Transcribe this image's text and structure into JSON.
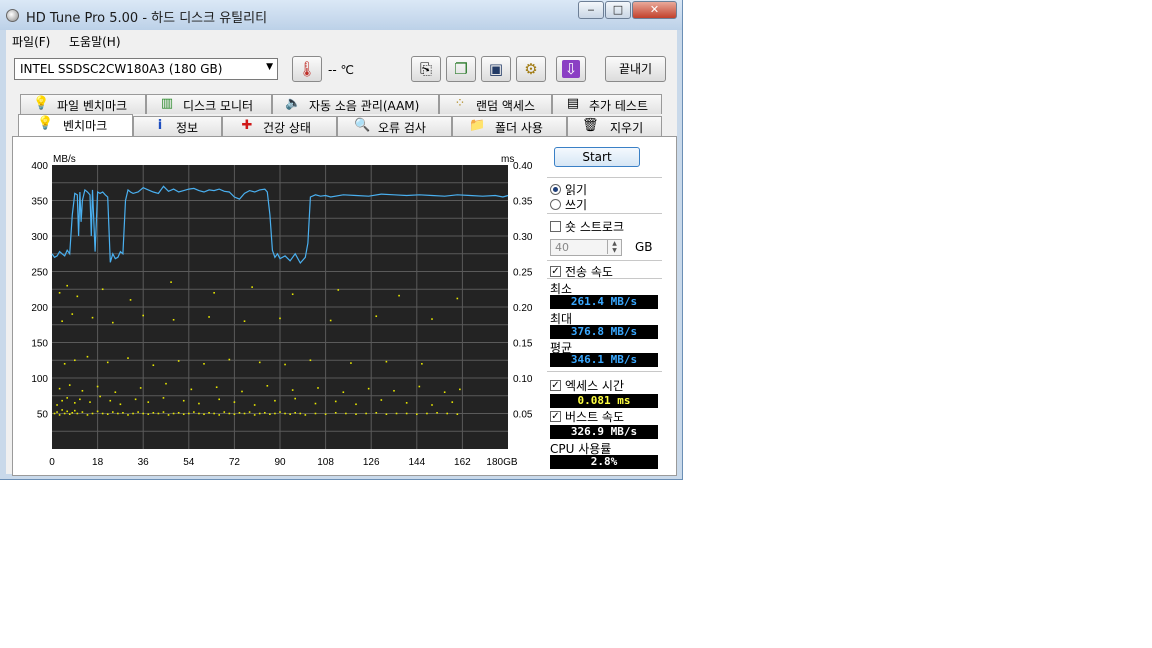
{
  "window": {
    "title": "HD Tune Pro 5.00 - 하드 디스크 유틸리티",
    "controls": {
      "minimize": "‒",
      "maximize": "□",
      "close": "✕"
    }
  },
  "menu": {
    "file": "파일(F)",
    "help": "도움말(H)"
  },
  "toolbar": {
    "drive": "INTEL SSDSC2CW180A3 (180 GB)",
    "temperature": "-- ℃",
    "exit_label": "끝내기",
    "icons": [
      "thermometer-icon",
      "copy-icon",
      "copy-all-icon",
      "save-icon",
      "options-icon",
      "download-icon"
    ]
  },
  "tabs_top": [
    "파일 벤치마크",
    "디스크 모니터",
    "자동 소음 관리(AAM)",
    "랜덤 액세스",
    "추가 테스트"
  ],
  "tabs_bottom": [
    "벤치마크",
    "정보",
    "건강 상태",
    "오류 검사",
    "폴더 사용",
    "지우기"
  ],
  "active_tab": "벤치마크",
  "controls": {
    "start_label": "Start",
    "read_label": "읽기",
    "write_label": "쓰기",
    "mode": "read",
    "short_stroke_label": "숏 스트로크",
    "short_stroke_checked": false,
    "short_stroke_value": "40",
    "short_stroke_unit": "GB",
    "transfer_rate_label": "전송 속도",
    "transfer_rate_checked": true,
    "min_label": "최소",
    "min_value": "261.4 MB/s",
    "max_label": "최대",
    "max_value": "376.8 MB/s",
    "avg_label": "평균",
    "avg_value": "346.1 MB/s",
    "access_time_label": "엑세스 시간",
    "access_time_checked": true,
    "access_time_value": "0.081 ms",
    "burst_label": "버스트 속도",
    "burst_checked": true,
    "burst_value": "326.9 MB/s",
    "cpu_label": "CPU 사용률",
    "cpu_value": "2.8%"
  },
  "colors": {
    "line": "#4ab0f0",
    "points": "#e8e800",
    "value_blue": "#3aa8ff",
    "value_yellow": "#ffff40",
    "value_white": "#ffffff"
  },
  "chart_data": {
    "type": "line",
    "left_unit": "MB/s",
    "right_unit": "ms",
    "x_ticks": [
      "0",
      "18",
      "36",
      "54",
      "72",
      "90",
      "108",
      "126",
      "144",
      "162",
      "180GB"
    ],
    "y_left_ticks": [
      "400",
      "350",
      "300",
      "250",
      "200",
      "150",
      "100",
      "50"
    ],
    "y_right_ticks": [
      "0.40",
      "0.35",
      "0.30",
      "0.25",
      "0.20",
      "0.15",
      "0.10",
      "0.05"
    ],
    "xlim": [
      0,
      180
    ],
    "ylim_left": [
      0,
      400
    ],
    "ylim_right": [
      0,
      0.4
    ],
    "grid": true,
    "series": [
      {
        "axis": "left",
        "x": [
          0,
          1,
          2,
          3,
          4,
          5,
          6,
          7,
          8,
          9,
          10,
          10.5,
          11,
          11.5,
          12,
          13,
          14,
          15,
          15.5,
          16,
          17,
          18,
          19,
          20,
          21,
          22,
          23,
          24,
          25,
          26,
          27,
          28,
          29,
          30,
          31,
          32,
          34,
          36,
          38,
          40,
          42,
          44,
          46,
          48,
          50,
          52,
          54,
          56,
          58,
          60,
          62,
          64,
          66,
          68,
          70,
          72,
          74,
          76,
          78,
          80,
          82,
          84,
          85,
          86,
          87,
          88,
          89,
          90,
          92,
          94,
          96,
          98,
          100,
          101,
          102,
          104,
          106,
          108,
          110,
          115,
          120,
          125,
          130,
          135,
          140,
          145,
          150,
          155,
          160,
          165,
          170,
          175,
          178,
          180
        ],
        "y": [
          275,
          270,
          272,
          278,
          275,
          272,
          280,
          275,
          330,
          360,
          358,
          300,
          362,
          320,
          350,
          365,
          362,
          358,
          300,
          365,
          278,
          362,
          360,
          362,
          358,
          355,
          263,
          275,
          268,
          270,
          278,
          275,
          350,
          365,
          362,
          360,
          362,
          368,
          365,
          362,
          360,
          370,
          363,
          366,
          362,
          364,
          366,
          367,
          364,
          362,
          365,
          364,
          366,
          363,
          362,
          355,
          352,
          360,
          364,
          362,
          365,
          366,
          362,
          330,
          280,
          270,
          275,
          268,
          272,
          265,
          275,
          262,
          270,
          290,
          355,
          358,
          356,
          357,
          355,
          358,
          357,
          356,
          359,
          358,
          357,
          358,
          357,
          356,
          358,
          357,
          356,
          357,
          355,
          357
        ]
      },
      {
        "axis": "right",
        "type": "scatter",
        "note_points": "access time samples",
        "x": [
          1,
          2,
          3,
          4,
          5,
          6,
          7,
          8,
          9,
          10,
          12,
          14,
          16,
          18,
          20,
          22,
          24,
          26,
          28,
          30,
          32,
          34,
          36,
          38,
          40,
          42,
          44,
          46,
          48,
          50,
          52,
          54,
          56,
          58,
          60,
          62,
          64,
          66,
          68,
          70,
          72,
          74,
          76,
          78,
          80,
          82,
          84,
          86,
          88,
          90,
          92,
          94,
          96,
          98,
          100,
          104,
          108,
          112,
          116,
          120,
          124,
          128,
          132,
          136,
          140,
          144,
          148,
          152,
          156,
          160,
          2,
          4,
          6,
          9,
          11,
          15,
          19,
          23,
          27,
          33,
          38,
          44,
          52,
          58,
          66,
          72,
          80,
          88,
          96,
          104,
          112,
          120,
          130,
          140,
          150,
          158,
          3,
          7,
          12,
          18,
          25,
          35,
          45,
          55,
          65,
          75,
          85,
          95,
          105,
          115,
          125,
          135,
          145,
          155,
          161,
          5,
          9,
          14,
          22,
          30,
          40,
          50,
          60,
          70,
          82,
          92,
          102,
          118,
          132,
          146,
          4,
          8,
          16,
          24,
          36,
          48,
          62,
          76,
          90,
          110,
          128,
          150,
          3,
          6,
          10,
          20,
          31,
          47,
          64,
          79,
          95,
          113,
          137,
          160
        ],
        "y": [
          0.05,
          0.052,
          0.048,
          0.055,
          0.05,
          0.053,
          0.049,
          0.051,
          0.054,
          0.05,
          0.052,
          0.048,
          0.05,
          0.053,
          0.05,
          0.049,
          0.052,
          0.05,
          0.051,
          0.048,
          0.05,
          0.052,
          0.05,
          0.049,
          0.051,
          0.05,
          0.052,
          0.048,
          0.05,
          0.051,
          0.049,
          0.05,
          0.052,
          0.05,
          0.049,
          0.051,
          0.05,
          0.048,
          0.052,
          0.05,
          0.049,
          0.051,
          0.05,
          0.052,
          0.048,
          0.05,
          0.051,
          0.049,
          0.05,
          0.052,
          0.05,
          0.049,
          0.051,
          0.05,
          0.048,
          0.05,
          0.049,
          0.051,
          0.05,
          0.049,
          0.05,
          0.051,
          0.049,
          0.05,
          0.05,
          0.049,
          0.05,
          0.051,
          0.05,
          0.049,
          0.062,
          0.068,
          0.072,
          0.065,
          0.07,
          0.066,
          0.074,
          0.068,
          0.063,
          0.07,
          0.066,
          0.072,
          0.068,
          0.064,
          0.07,
          0.066,
          0.062,
          0.068,
          0.071,
          0.064,
          0.067,
          0.063,
          0.069,
          0.065,
          0.062,
          0.066,
          0.085,
          0.09,
          0.082,
          0.088,
          0.08,
          0.086,
          0.092,
          0.084,
          0.087,
          0.081,
          0.089,
          0.083,
          0.086,
          0.08,
          0.085,
          0.082,
          0.088,
          0.08,
          0.084,
          0.12,
          0.125,
          0.13,
          0.122,
          0.128,
          0.118,
          0.124,
          0.12,
          0.126,
          0.122,
          0.119,
          0.125,
          0.121,
          0.123,
          0.12,
          0.18,
          0.19,
          0.185,
          0.178,
          0.188,
          0.182,
          0.186,
          0.18,
          0.184,
          0.181,
          0.187,
          0.183,
          0.22,
          0.23,
          0.215,
          0.225,
          0.21,
          0.235,
          0.22,
          0.228,
          0.218,
          0.224,
          0.216,
          0.212
        ]
      }
    ]
  }
}
